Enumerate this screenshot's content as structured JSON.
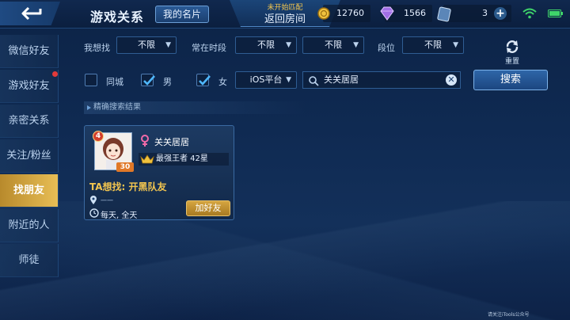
{
  "header": {
    "title": "游戏关系",
    "namecard_label": "我的名片",
    "return_room_sub": "未开始匹配",
    "return_room_label": "返回房间",
    "gold": "12760",
    "diamond": "1566",
    "voucher": "3"
  },
  "sidebar": {
    "items": [
      {
        "label": "微信好友"
      },
      {
        "label": "游戏好友"
      },
      {
        "label": "亲密关系"
      },
      {
        "label": "关注/粉丝"
      },
      {
        "label": "找朋友"
      },
      {
        "label": "附近的人"
      },
      {
        "label": "师徒"
      }
    ]
  },
  "filters": {
    "want_label": "我想找",
    "want_value": "不限",
    "time_label": "常在时段",
    "time_value1": "不限",
    "time_value2": "不限",
    "tier_label": "段位",
    "tier_value": "不限",
    "reset_label": "重置",
    "same_city_label": "同城",
    "same_city_checked": false,
    "male_label": "男",
    "male_checked": true,
    "female_label": "女",
    "female_checked": true,
    "platform_value": "iOS平台",
    "search_value": "关关居居",
    "search_button": "搜索"
  },
  "results": {
    "section_title": "精确搜索结果",
    "card": {
      "rank_badge": "4",
      "level": "30",
      "name": "关关居居",
      "rank_text": "最强王者 42星",
      "wants": "TA想找: 开黑队友",
      "location": "一一",
      "time": "每天, 全天",
      "add_button": "加好友"
    }
  },
  "watermark": "请关注iTools公众号",
  "colors": {
    "accent_gold": "#e8be55",
    "accent_blue": "#2e66a8",
    "text_gold": "#f2c54f"
  }
}
